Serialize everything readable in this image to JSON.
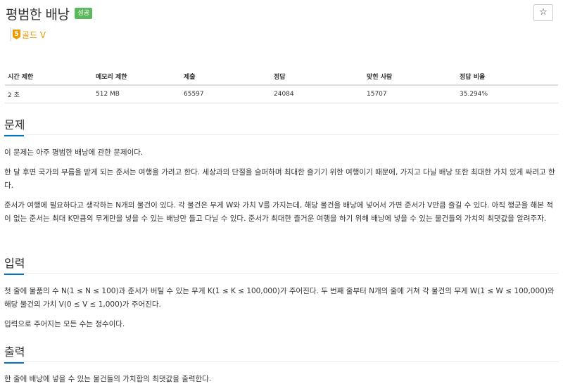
{
  "problem": {
    "title": "평범한 배낭",
    "badge": "성공",
    "tier_number": "5",
    "tier_label": "골드 V",
    "star_icon": "☆"
  },
  "info_table": {
    "headers": [
      "시간 제한",
      "메모리 제한",
      "제출",
      "정답",
      "맞힌 사람",
      "정답 비율"
    ],
    "values": [
      "2 초",
      "512 MB",
      "65597",
      "24084",
      "15707",
      "35.294%"
    ]
  },
  "sections": {
    "problem_title": "문제",
    "problem_p1": "이 문제는 아주 평범한 배낭에 관한 문제이다.",
    "problem_p2": "한 달 후면 국가의 부름을 받게 되는 준서는 여행을 가려고 한다. 세상과의 단절을 슬퍼하며 최대한 즐기기 위한 여행이기 때문에, 가지고 다닐 배낭 또한 최대한 가치 있게 싸려고 한다.",
    "problem_p3": "준서가 여행에 필요하다고 생각하는 N개의 물건이 있다. 각 물건은 무게 W와 가치 V를 가지는데, 해당 물건을 배낭에 넣어서 가면 준서가 V만큼 즐길 수 있다. 아직 행군을 해본 적이 없는 준서는 최대 K만큼의 무게만을 넣을 수 있는 배낭만 들고 다닐 수 있다. 준서가 최대한 즐거운 여행을 하기 위해 배낭에 넣을 수 있는 물건들의 가치의 최댓값을 알려주자.",
    "input_title": "입력",
    "input_p1": "첫 줄에 물품의 수 N(1 ≤ N ≤ 100)과 준서가 버틸 수 있는 무게 K(1 ≤ K ≤ 100,000)가 주어진다. 두 번째 줄부터 N개의 줄에 거쳐 각 물건의 무게 W(1 ≤ W ≤ 100,000)와 해당 물건의 가치 V(0 ≤ V ≤ 1,000)가 주어진다.",
    "input_p2": "입력으로 주어지는 모든 수는 정수이다.",
    "output_title": "출력",
    "output_p1": "한 줄에 배낭에 넣을 수 있는 물건들의 가치합의 최댓값을 출력한다."
  }
}
